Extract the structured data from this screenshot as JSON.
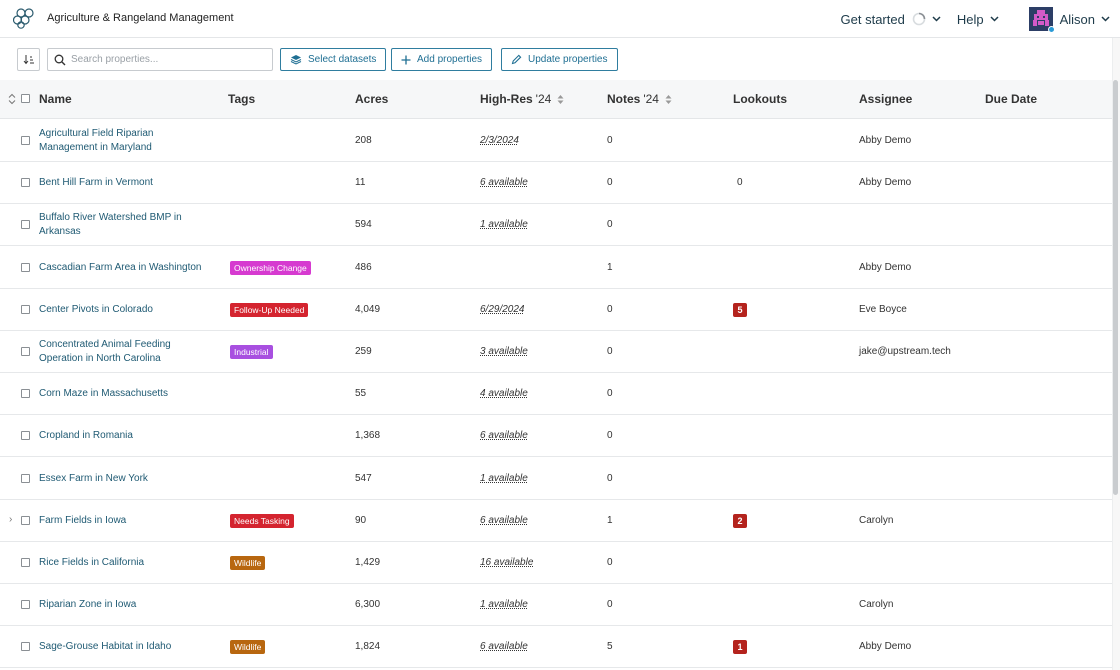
{
  "header": {
    "org_name": "Agriculture & Rangeland Management",
    "get_started": "Get started",
    "help": "Help",
    "user_name": "Alison"
  },
  "toolbar": {
    "search_placeholder": "Search properties...",
    "search_value": "",
    "select_datasets": "Select datasets",
    "add_properties": "Add properties",
    "update_properties": "Update properties"
  },
  "table": {
    "columns": {
      "name": "Name",
      "tags": "Tags",
      "acres": "Acres",
      "highres": "High-Res",
      "highres_suffix": "'24",
      "notes": "Notes",
      "notes_suffix": "'24",
      "lookouts": "Lookouts",
      "assignee": "Assignee",
      "due_date": "Due Date"
    },
    "rows": [
      {
        "name": "Agricultural Field Riparian Management in Maryland",
        "tag": "",
        "acres": "208",
        "highres": "2/3/2024",
        "notes": "0",
        "lookouts": "",
        "assignee": "Abby Demo"
      },
      {
        "name": "Bent Hill Farm in Vermont",
        "tag": "",
        "acres": "11",
        "highres": "6 available",
        "notes": "0",
        "lookouts": "0",
        "assignee": "Abby Demo"
      },
      {
        "name": "Buffalo River Watershed BMP in Arkansas",
        "tag": "",
        "acres": "594",
        "highres": "1 available",
        "notes": "0",
        "lookouts": "",
        "assignee": ""
      },
      {
        "name": "Cascadian Farm Area in Washington",
        "tag": "Ownership Change",
        "acres": "486",
        "highres": "",
        "notes": "1",
        "lookouts": "",
        "assignee": "Abby Demo"
      },
      {
        "name": "Center Pivots in Colorado",
        "tag": "Follow-Up Needed",
        "acres": "4,049",
        "highres": "6/29/2024",
        "notes": "0",
        "lookouts": "5",
        "assignee": "Eve Boyce"
      },
      {
        "name": "Concentrated Animal Feeding Operation in North Carolina",
        "tag": "Industrial",
        "acres": "259",
        "highres": "3 available",
        "notes": "0",
        "lookouts": "",
        "assignee": "jake@upstream.tech"
      },
      {
        "name": "Corn Maze in Massachusetts",
        "tag": "",
        "acres": "55",
        "highres": "4 available",
        "notes": "0",
        "lookouts": "",
        "assignee": ""
      },
      {
        "name": "Cropland in Romania",
        "tag": "",
        "acres": "1,368",
        "highres": "6 available",
        "notes": "0",
        "lookouts": "",
        "assignee": ""
      },
      {
        "name": "Essex Farm in New York",
        "tag": "",
        "acres": "547",
        "highres": "1 available",
        "notes": "0",
        "lookouts": "",
        "assignee": ""
      },
      {
        "name": "Farm Fields in Iowa",
        "tag": "Needs Tasking",
        "acres": "90",
        "highres": "6 available",
        "notes": "1",
        "lookouts": "2",
        "assignee": "Carolyn"
      },
      {
        "name": "Rice Fields in California",
        "tag": "Wildlife",
        "acres": "1,429",
        "highres": "16 available",
        "notes": "0",
        "lookouts": "",
        "assignee": ""
      },
      {
        "name": "Riparian Zone in Iowa",
        "tag": "",
        "acres": "6,300",
        "highres": "1 available",
        "notes": "0",
        "lookouts": "",
        "assignee": "Carolyn"
      },
      {
        "name": "Sage-Grouse Habitat in Idaho",
        "tag": "Wildlife",
        "acres": "1,824",
        "highres": "6 available",
        "notes": "5",
        "lookouts": "1",
        "assignee": "Abby Demo"
      }
    ]
  },
  "colors": {
    "accent": "#1f6f93",
    "tag_ownership_change": "#d63ad0",
    "tag_follow_up_needed": "#d4242f",
    "tag_industrial": "#a84fe0",
    "tag_needs_tasking": "#d4242f",
    "tag_wildlife": "#b8670f",
    "lookout_badge": "#b4231d"
  },
  "icons": {
    "logo": "hexagon-cluster-icon",
    "spinner": "loading-spinner-icon",
    "sort": "sort-icon",
    "search": "search-icon",
    "datasets": "layers-icon",
    "add": "plus-icon",
    "edit": "pencil-icon"
  }
}
